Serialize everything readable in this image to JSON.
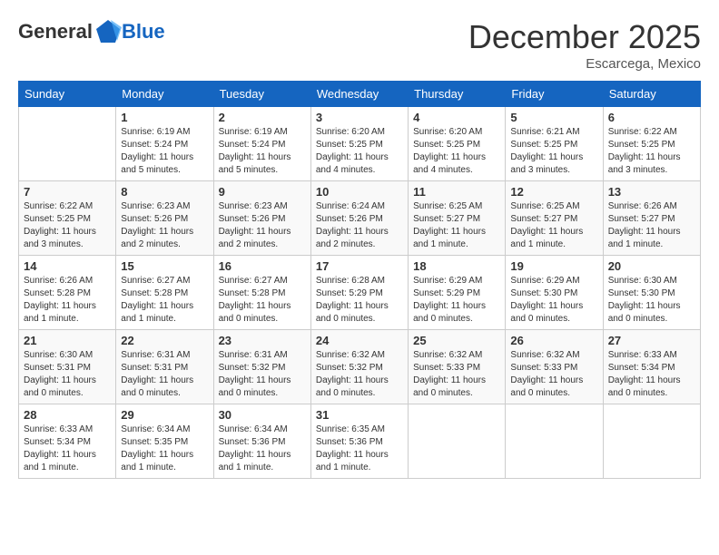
{
  "logo": {
    "general": "General",
    "blue": "Blue"
  },
  "header": {
    "month": "December 2025",
    "location": "Escarcega, Mexico"
  },
  "weekdays": [
    "Sunday",
    "Monday",
    "Tuesday",
    "Wednesday",
    "Thursday",
    "Friday",
    "Saturday"
  ],
  "weeks": [
    [
      {
        "day": "",
        "sunrise": "",
        "sunset": "",
        "daylight": ""
      },
      {
        "day": "1",
        "sunrise": "Sunrise: 6:19 AM",
        "sunset": "Sunset: 5:24 PM",
        "daylight": "Daylight: 11 hours and 5 minutes."
      },
      {
        "day": "2",
        "sunrise": "Sunrise: 6:19 AM",
        "sunset": "Sunset: 5:24 PM",
        "daylight": "Daylight: 11 hours and 5 minutes."
      },
      {
        "day": "3",
        "sunrise": "Sunrise: 6:20 AM",
        "sunset": "Sunset: 5:25 PM",
        "daylight": "Daylight: 11 hours and 4 minutes."
      },
      {
        "day": "4",
        "sunrise": "Sunrise: 6:20 AM",
        "sunset": "Sunset: 5:25 PM",
        "daylight": "Daylight: 11 hours and 4 minutes."
      },
      {
        "day": "5",
        "sunrise": "Sunrise: 6:21 AM",
        "sunset": "Sunset: 5:25 PM",
        "daylight": "Daylight: 11 hours and 3 minutes."
      },
      {
        "day": "6",
        "sunrise": "Sunrise: 6:22 AM",
        "sunset": "Sunset: 5:25 PM",
        "daylight": "Daylight: 11 hours and 3 minutes."
      }
    ],
    [
      {
        "day": "7",
        "sunrise": "Sunrise: 6:22 AM",
        "sunset": "Sunset: 5:25 PM",
        "daylight": "Daylight: 11 hours and 3 minutes."
      },
      {
        "day": "8",
        "sunrise": "Sunrise: 6:23 AM",
        "sunset": "Sunset: 5:26 PM",
        "daylight": "Daylight: 11 hours and 2 minutes."
      },
      {
        "day": "9",
        "sunrise": "Sunrise: 6:23 AM",
        "sunset": "Sunset: 5:26 PM",
        "daylight": "Daylight: 11 hours and 2 minutes."
      },
      {
        "day": "10",
        "sunrise": "Sunrise: 6:24 AM",
        "sunset": "Sunset: 5:26 PM",
        "daylight": "Daylight: 11 hours and 2 minutes."
      },
      {
        "day": "11",
        "sunrise": "Sunrise: 6:25 AM",
        "sunset": "Sunset: 5:27 PM",
        "daylight": "Daylight: 11 hours and 1 minute."
      },
      {
        "day": "12",
        "sunrise": "Sunrise: 6:25 AM",
        "sunset": "Sunset: 5:27 PM",
        "daylight": "Daylight: 11 hours and 1 minute."
      },
      {
        "day": "13",
        "sunrise": "Sunrise: 6:26 AM",
        "sunset": "Sunset: 5:27 PM",
        "daylight": "Daylight: 11 hours and 1 minute."
      }
    ],
    [
      {
        "day": "14",
        "sunrise": "Sunrise: 6:26 AM",
        "sunset": "Sunset: 5:28 PM",
        "daylight": "Daylight: 11 hours and 1 minute."
      },
      {
        "day": "15",
        "sunrise": "Sunrise: 6:27 AM",
        "sunset": "Sunset: 5:28 PM",
        "daylight": "Daylight: 11 hours and 1 minute."
      },
      {
        "day": "16",
        "sunrise": "Sunrise: 6:27 AM",
        "sunset": "Sunset: 5:28 PM",
        "daylight": "Daylight: 11 hours and 0 minutes."
      },
      {
        "day": "17",
        "sunrise": "Sunrise: 6:28 AM",
        "sunset": "Sunset: 5:29 PM",
        "daylight": "Daylight: 11 hours and 0 minutes."
      },
      {
        "day": "18",
        "sunrise": "Sunrise: 6:29 AM",
        "sunset": "Sunset: 5:29 PM",
        "daylight": "Daylight: 11 hours and 0 minutes."
      },
      {
        "day": "19",
        "sunrise": "Sunrise: 6:29 AM",
        "sunset": "Sunset: 5:30 PM",
        "daylight": "Daylight: 11 hours and 0 minutes."
      },
      {
        "day": "20",
        "sunrise": "Sunrise: 6:30 AM",
        "sunset": "Sunset: 5:30 PM",
        "daylight": "Daylight: 11 hours and 0 minutes."
      }
    ],
    [
      {
        "day": "21",
        "sunrise": "Sunrise: 6:30 AM",
        "sunset": "Sunset: 5:31 PM",
        "daylight": "Daylight: 11 hours and 0 minutes."
      },
      {
        "day": "22",
        "sunrise": "Sunrise: 6:31 AM",
        "sunset": "Sunset: 5:31 PM",
        "daylight": "Daylight: 11 hours and 0 minutes."
      },
      {
        "day": "23",
        "sunrise": "Sunrise: 6:31 AM",
        "sunset": "Sunset: 5:32 PM",
        "daylight": "Daylight: 11 hours and 0 minutes."
      },
      {
        "day": "24",
        "sunrise": "Sunrise: 6:32 AM",
        "sunset": "Sunset: 5:32 PM",
        "daylight": "Daylight: 11 hours and 0 minutes."
      },
      {
        "day": "25",
        "sunrise": "Sunrise: 6:32 AM",
        "sunset": "Sunset: 5:33 PM",
        "daylight": "Daylight: 11 hours and 0 minutes."
      },
      {
        "day": "26",
        "sunrise": "Sunrise: 6:32 AM",
        "sunset": "Sunset: 5:33 PM",
        "daylight": "Daylight: 11 hours and 0 minutes."
      },
      {
        "day": "27",
        "sunrise": "Sunrise: 6:33 AM",
        "sunset": "Sunset: 5:34 PM",
        "daylight": "Daylight: 11 hours and 0 minutes."
      }
    ],
    [
      {
        "day": "28",
        "sunrise": "Sunrise: 6:33 AM",
        "sunset": "Sunset: 5:34 PM",
        "daylight": "Daylight: 11 hours and 1 minute."
      },
      {
        "day": "29",
        "sunrise": "Sunrise: 6:34 AM",
        "sunset": "Sunset: 5:35 PM",
        "daylight": "Daylight: 11 hours and 1 minute."
      },
      {
        "day": "30",
        "sunrise": "Sunrise: 6:34 AM",
        "sunset": "Sunset: 5:36 PM",
        "daylight": "Daylight: 11 hours and 1 minute."
      },
      {
        "day": "31",
        "sunrise": "Sunrise: 6:35 AM",
        "sunset": "Sunset: 5:36 PM",
        "daylight": "Daylight: 11 hours and 1 minute."
      },
      {
        "day": "",
        "sunrise": "",
        "sunset": "",
        "daylight": ""
      },
      {
        "day": "",
        "sunrise": "",
        "sunset": "",
        "daylight": ""
      },
      {
        "day": "",
        "sunrise": "",
        "sunset": "",
        "daylight": ""
      }
    ]
  ]
}
